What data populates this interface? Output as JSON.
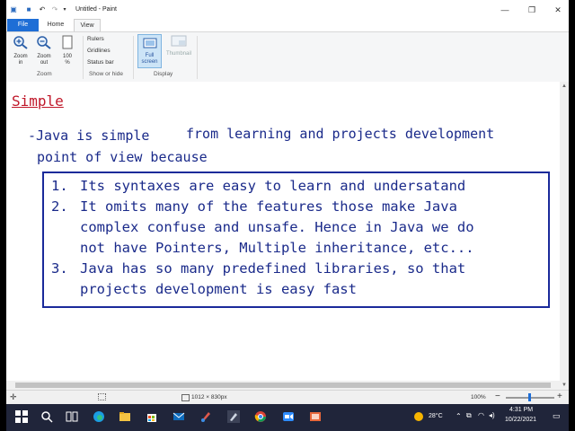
{
  "window": {
    "title": "Untitled - Paint"
  },
  "tabs": {
    "file": "File",
    "home": "Home",
    "view": "View"
  },
  "ribbon": {
    "zoom_in": [
      "Zoom",
      "in"
    ],
    "zoom_out": [
      "Zoom",
      "out"
    ],
    "zoom_100": [
      "100",
      "%"
    ],
    "zoom_group": "Zoom",
    "rulers": "Rulers",
    "gridlines": "Gridlines",
    "status_bar": "Status bar",
    "rulers_checked": false,
    "gridlines_checked": false,
    "status_bar_checked": true,
    "show_hide_group": "Show or hide",
    "full_screen": [
      "Full",
      "screen"
    ],
    "thumbnail": "Thumbnail",
    "display_group": "Display"
  },
  "canvas": {
    "heading": "Simple",
    "line1a": "-Java is simple",
    "line1b": "from learning and projects development",
    "line2": "point of view because",
    "items": [
      {
        "num": "1.",
        "text": "Its syntaxes are easy to learn and undersatand"
      },
      {
        "num": "2.",
        "text": "It omits many of the features those make Java"
      },
      {
        "num": "",
        "text": "complex confuse and unsafe. Hence in Java we do"
      },
      {
        "num": "",
        "text": "not have Pointers, Multiple inheritance, etc..."
      },
      {
        "num": "3.",
        "text": "Java has so many predefined libraries, so that"
      },
      {
        "num": "",
        "text": "projects development is easy fast"
      }
    ]
  },
  "statusbar": {
    "image_size": "1012 × 830px",
    "zoom": "100%"
  },
  "taskbar": {
    "temperature": "28°C",
    "time": "4:31 PM",
    "date": "10/22/2021"
  },
  "colors": {
    "accent": "#1e6ed6",
    "heading": "#c0182a",
    "text": "#1a2a8a"
  }
}
